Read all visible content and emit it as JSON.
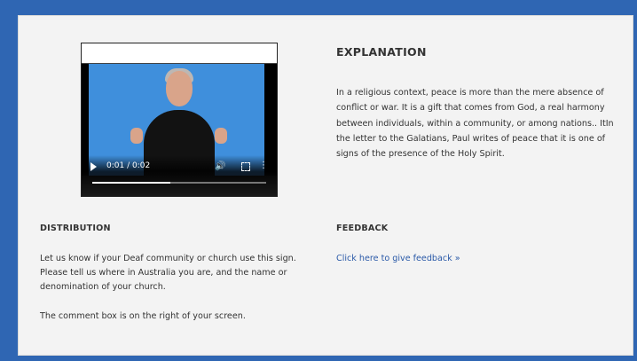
{
  "video": {
    "time": "0:01 / 0:02",
    "progress_fraction": 0.45,
    "icons": {
      "play": "play-icon",
      "volume": "volume-icon",
      "fullscreen": "fullscreen-icon",
      "more": "more-options-icon"
    }
  },
  "explanation": {
    "heading": "EXPLANATION",
    "text": "In a religious context, peace is more than the mere absence of conflict or war. It is a gift that comes from God, a real harmony between individuals, within a community, or among nations.. ItIn the letter to the Galatians, Paul writes of peace that it is one of signs of the presence of the Holy Spirit."
  },
  "distribution": {
    "heading": "DISTRIBUTION",
    "paragraph1": "Let us know if your Deaf community or church use this sign. Please tell us where in Australia you are, and the name or denomination of your church.",
    "paragraph2": "The comment box is on the right of your screen."
  },
  "feedback": {
    "heading": "FEEDBACK",
    "link": "Click here to give feedback »"
  },
  "colors": {
    "frame": "#2f66b3",
    "panel": "#f3f3f3",
    "link": "#2b5aa8"
  }
}
